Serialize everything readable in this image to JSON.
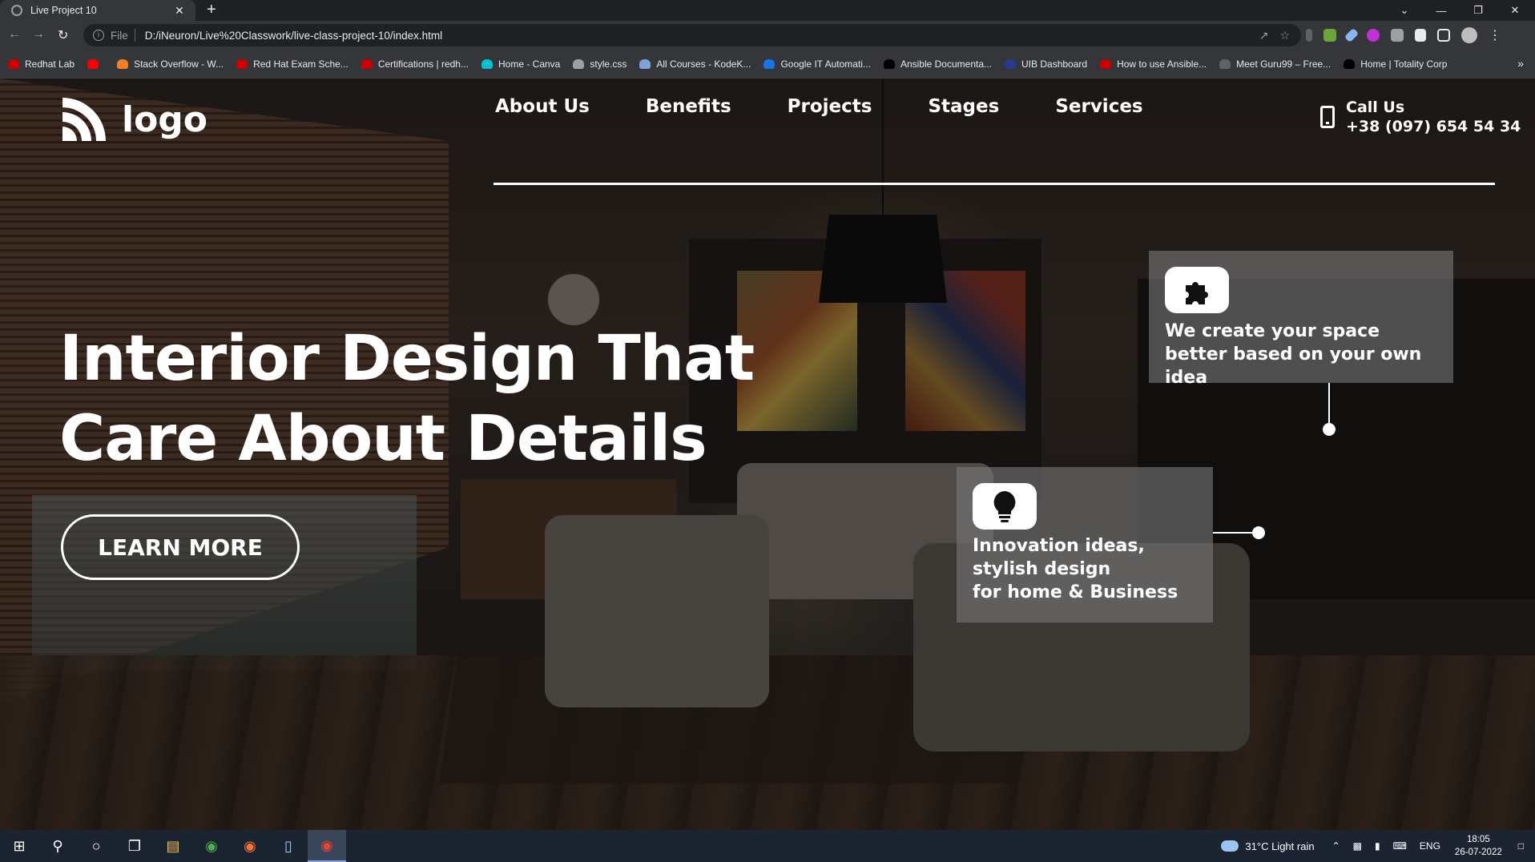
{
  "browser": {
    "tab_title": "Live Project 10",
    "tab_close": "✕",
    "new_tab": "+",
    "window_controls": [
      "⌄",
      "—",
      "❐",
      "✕"
    ],
    "file_label": "File",
    "url": "D:/iNeuron/Live%20Classwork/live-class-project-10/index.html",
    "bookmarks": [
      {
        "label": "Redhat Lab",
        "color": "#cc0000"
      },
      {
        "label": "",
        "color": "#ff0000"
      },
      {
        "label": "Stack Overflow - W...",
        "color": "#f48024"
      },
      {
        "label": "Red Hat Exam Sche...",
        "color": "#cc0000"
      },
      {
        "label": "Certifications | redh...",
        "color": "#cc0000"
      },
      {
        "label": "Home - Canva",
        "color": "#00c4cc"
      },
      {
        "label": "style.css",
        "color": "#9aa0a6"
      },
      {
        "label": "All Courses - KodeK...",
        "color": "#7ea3d8"
      },
      {
        "label": "Google IT Automati...",
        "color": "#1a73e8"
      },
      {
        "label": "Ansible Documenta...",
        "color": "#000000"
      },
      {
        "label": "UIB Dashboard",
        "color": "#2a3a8a"
      },
      {
        "label": "How to use Ansible...",
        "color": "#cc0000"
      },
      {
        "label": "Meet Guru99 – Free...",
        "color": "#5f6368"
      },
      {
        "label": "Home | Totality Corp",
        "color": "#000000"
      }
    ],
    "bookmarks_more": "»"
  },
  "site": {
    "logo_text": "logo",
    "nav": [
      "About Us",
      "Benefits",
      "Projects",
      "Stages",
      "Services"
    ],
    "call_label": "Call Us",
    "call_number": "+38 (097) 654 54 34",
    "hero_line1": "Interior Design That",
    "hero_line2": "Care About Details",
    "cta_label": "LEARN MORE",
    "card1_text": "We create your space better based on your own idea",
    "card2_line1": "Innovation ideas, stylish design",
    "card2_line2": "for home & Business"
  },
  "taskbar": {
    "weather": "31°C  Light rain",
    "language": "ENG",
    "time": "18:05",
    "date": "26-07-2022"
  }
}
